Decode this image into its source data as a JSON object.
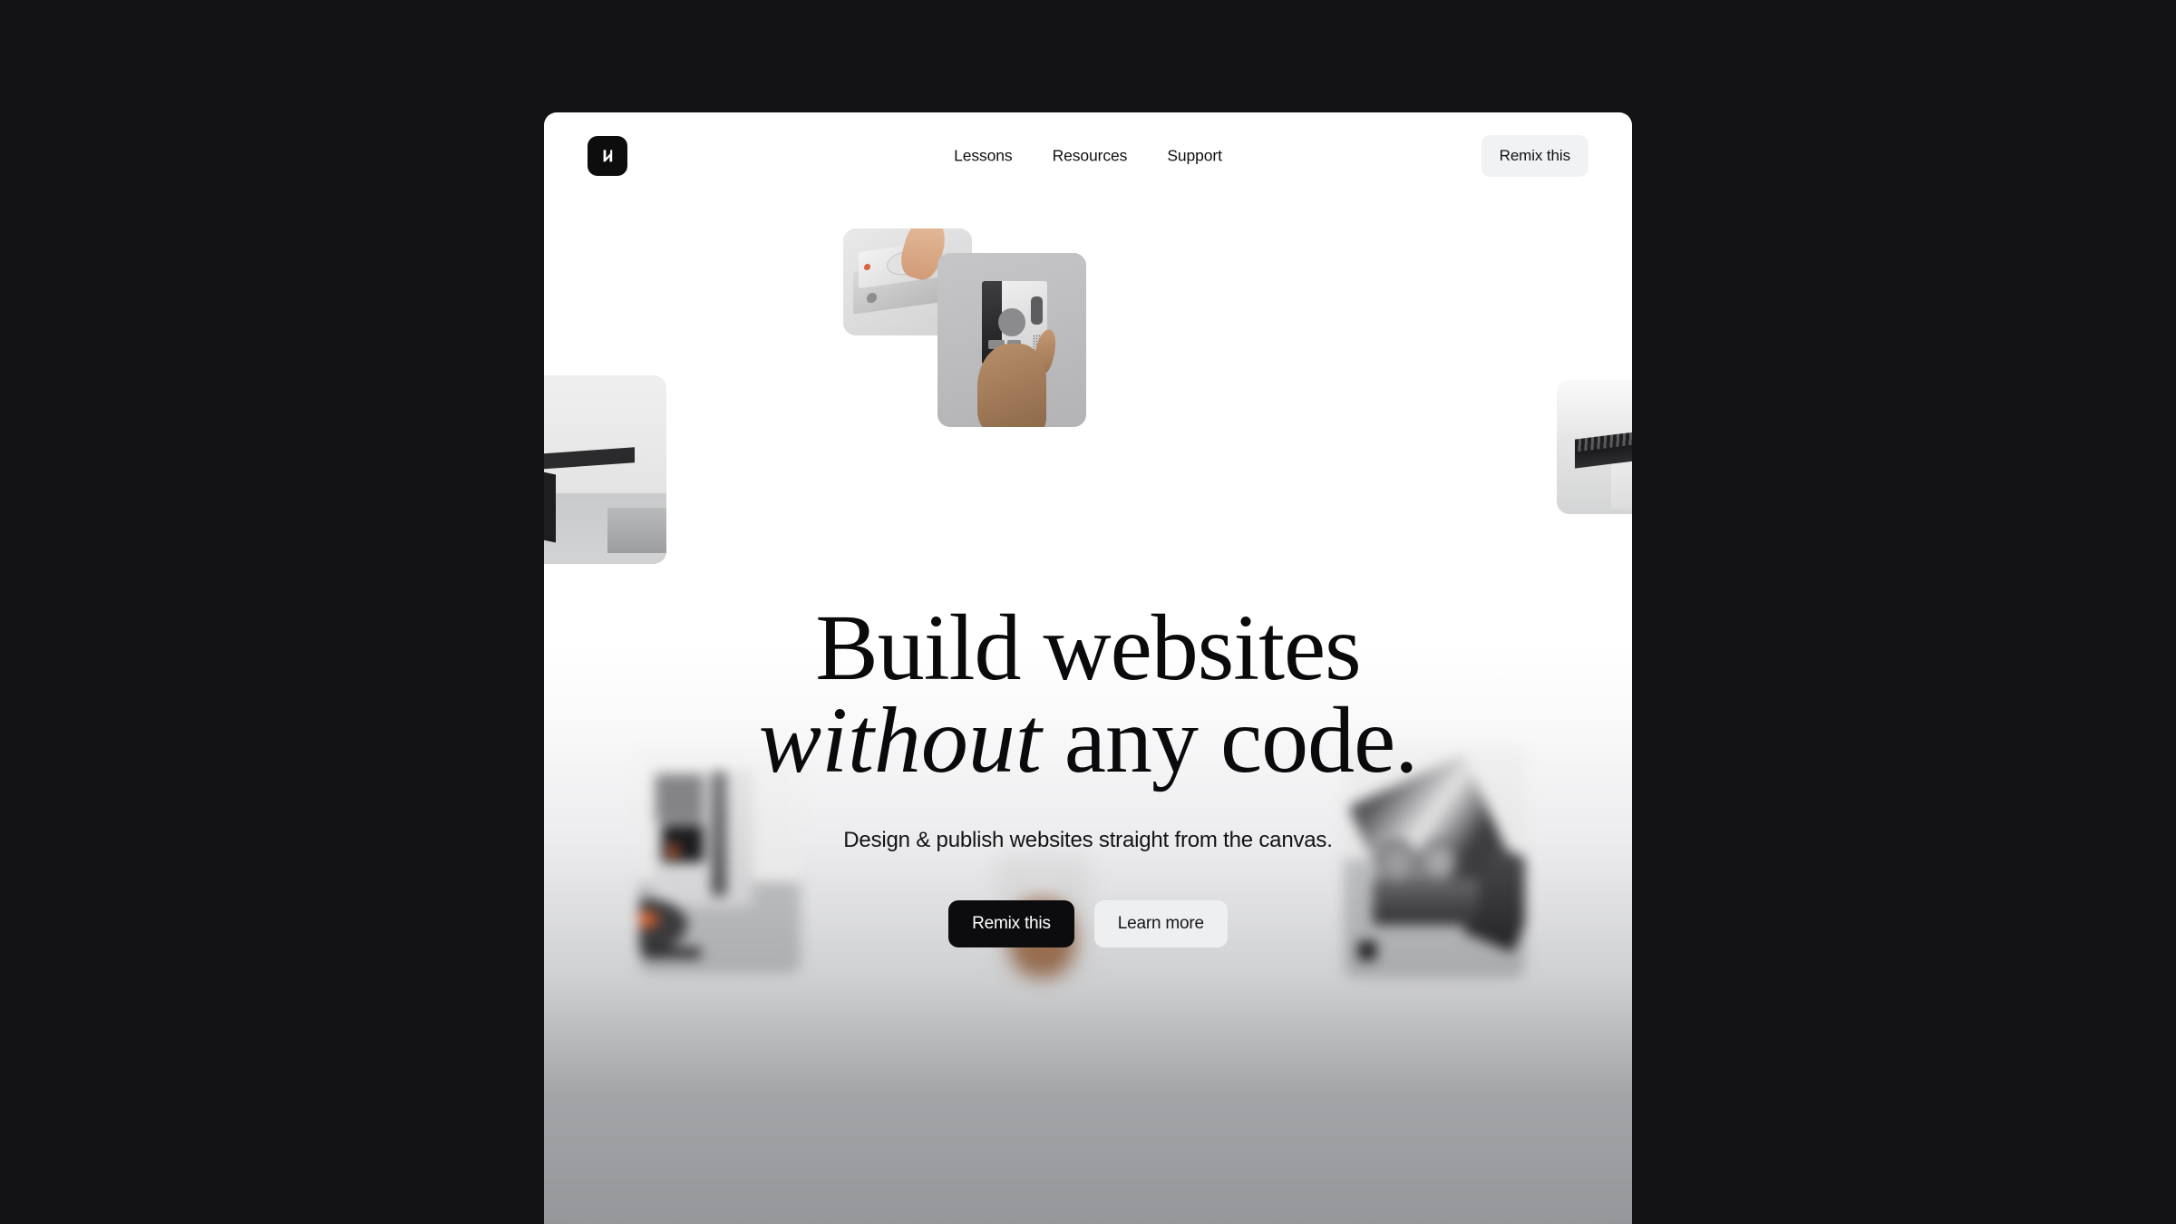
{
  "page": {
    "background_color": "#131316",
    "canvas_color": "#ffffff"
  },
  "nav": {
    "logo_name": "app-logo-mark",
    "links": [
      {
        "label": "Lessons"
      },
      {
        "label": "Resources"
      },
      {
        "label": "Support"
      }
    ],
    "cta_label": "Remix this"
  },
  "hero": {
    "headline_line1": "Build websites",
    "headline_italic": "without",
    "headline_rest": " any code.",
    "subheadline": "Design & publish websites straight from the canvas.",
    "primary_button": "Remix this",
    "secondary_button": "Learn more"
  },
  "media": {
    "cards": [
      {
        "name": "cd-player-photo",
        "alt": "Finger pressing a button on a portable CD player"
      },
      {
        "name": "cassette-photo",
        "alt": "Hand holding a silver cassette player"
      },
      {
        "name": "desk-photo",
        "alt": "Black desk with a monitor in a grey room"
      },
      {
        "name": "finned-photo",
        "alt": "Dark finned metal object on a shelf"
      },
      {
        "name": "radio-photo",
        "alt": "Portable radio and turntable, blurred"
      },
      {
        "name": "camera-photo",
        "alt": "Vintage camera with lenses, blurred"
      },
      {
        "name": "hand-photo",
        "alt": "Hand holding a small object, heavily blurred"
      }
    ]
  },
  "colors": {
    "accent_dark": "#0c0c0e",
    "chip_grey": "#f1f2f4",
    "button_grey": "#eeeff1",
    "text_dark": "#101012"
  }
}
